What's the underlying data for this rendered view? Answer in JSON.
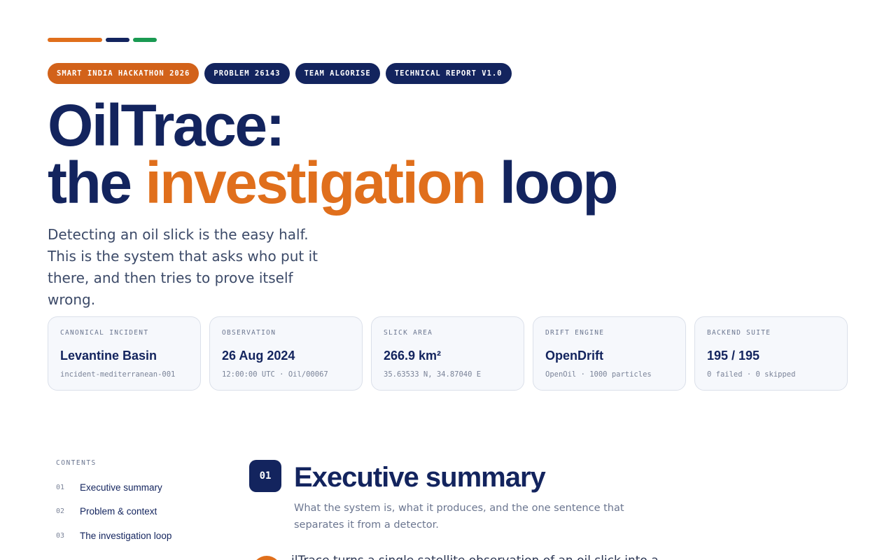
{
  "tags": [
    {
      "label": "SMART INDIA HACKATHON 2026"
    },
    {
      "label": "PROBLEM 26143"
    },
    {
      "label": "TEAM ALGORISE"
    },
    {
      "label": "TECHNICAL REPORT V1.0"
    }
  ],
  "hero": {
    "title_line1": "OilTrace:",
    "title_pre": "the ",
    "title_highlight": "investigation",
    "title_post": " loop",
    "subtitle": "Detecting an oil slick is the easy half. This is the system that asks who put it there, and then tries to prove itself wrong."
  },
  "cards": [
    {
      "label": "CANONICAL INCIDENT",
      "value": "Levantine Basin",
      "sub": "incident-mediterranean-001"
    },
    {
      "label": "OBSERVATION",
      "value": "26 Aug 2024",
      "sub": "12:00:00 UTC · Oil/00067"
    },
    {
      "label": "SLICK AREA",
      "value": "266.9 km²",
      "sub": "35.63533 N, 34.87040 E"
    },
    {
      "label": "DRIFT ENGINE",
      "value": "OpenDrift",
      "sub": "OpenOil · 1000 particles"
    },
    {
      "label": "BACKEND SUITE",
      "value": "195 / 195",
      "sub": "0 failed · 0 skipped"
    }
  ],
  "toc": {
    "heading": "CONTENTS",
    "items": [
      {
        "num": "01",
        "label": "Executive summary"
      },
      {
        "num": "02",
        "label": "Problem & context"
      },
      {
        "num": "03",
        "label": "The investigation loop"
      }
    ]
  },
  "section": {
    "number": "01",
    "title": "Executive summary",
    "description": "What the system is, what it produces, and the one sentence that separates it from a detector.",
    "body_start": "ilTrace turns a single satellite observation of an oil slick into a"
  },
  "colors": {
    "navy": "#13245e",
    "orange": "#e06f1c",
    "green": "#1a9a52"
  }
}
